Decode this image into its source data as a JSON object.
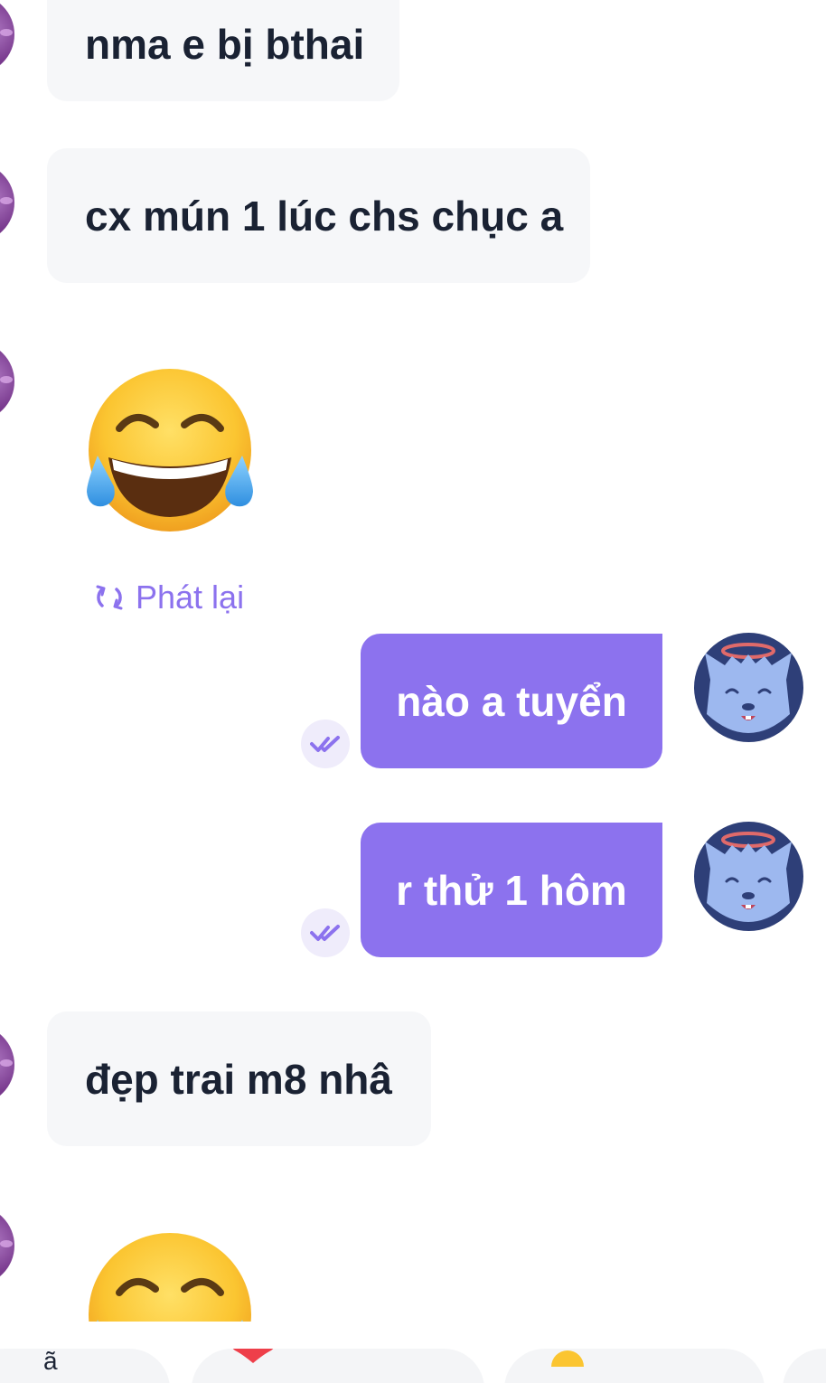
{
  "messages": {
    "m1": {
      "text": "nma e bị bthai"
    },
    "m2": {
      "text": "cx mún 1 lúc chs chục a"
    },
    "m3": {
      "emoji": "face-with-tears-of-joy"
    },
    "replay": {
      "label": "Phát lại",
      "icon": "replay-icon"
    },
    "m4": {
      "text": "nào a tuyển",
      "status_icon": "double-check-icon"
    },
    "m5": {
      "text": "r thử 1 hôm",
      "status_icon": "double-check-icon"
    },
    "m6": {
      "text": "đẹp trai m8 nhâ"
    },
    "m7": {
      "emoji": "face-with-tears-of-joy"
    }
  },
  "quick_bar": {
    "items": [
      {
        "text": "ã",
        "icon": "text-sticker"
      },
      {
        "icon": "heart-icon"
      },
      {
        "icon": "smile-icon"
      }
    ]
  },
  "colors": {
    "outgoing_bubble": "#8c72ee",
    "incoming_bubble": "#f6f7f9",
    "incoming_text": "#1a2233",
    "accent": "#8c72ee",
    "my_avatar_bg": "#2e3f78"
  }
}
